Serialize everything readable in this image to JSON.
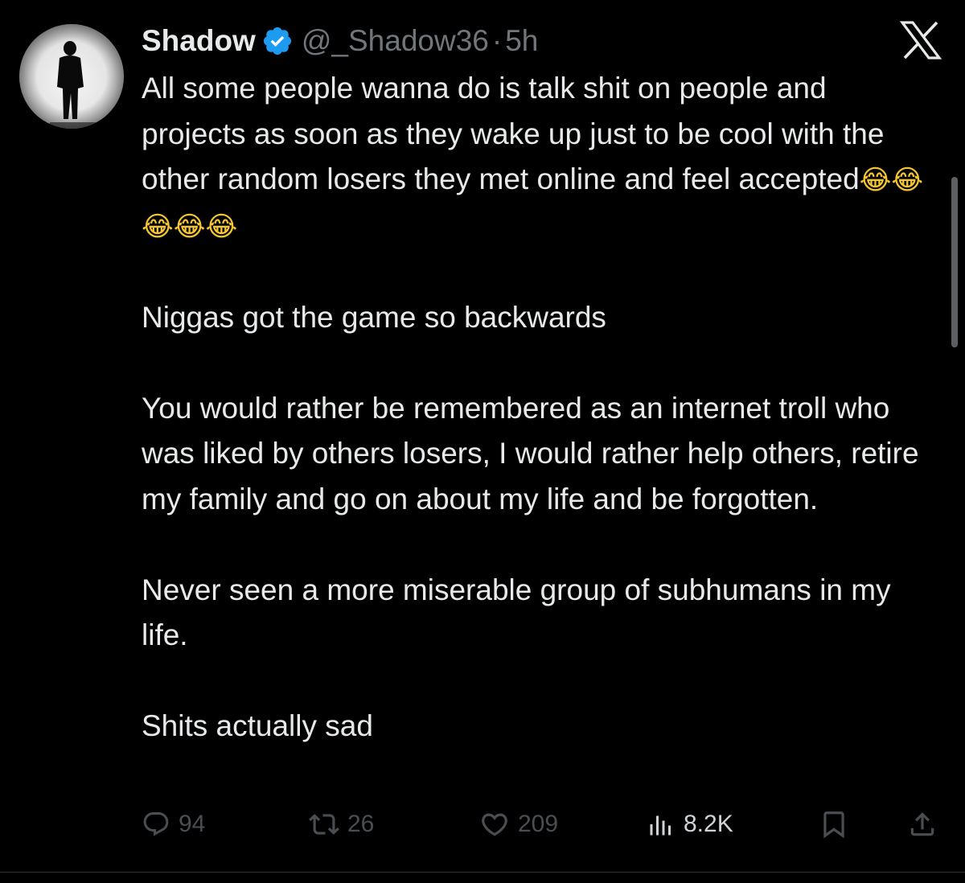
{
  "author": {
    "display_name": "Shadow",
    "handle": "@_Shadow36",
    "separator": "·",
    "timestamp": "5h",
    "verified": true,
    "verified_color": "#1d9bf0"
  },
  "app": {
    "logo_icon": "x-logo-icon"
  },
  "tweet": {
    "paragraphs": [
      "All some people wanna do is talk shit on people and projects as soon as they wake up just to be cool with the other random losers they met online and feel accepted",
      "Niggas got the game so backwards",
      "You would rather be remembered as an internet troll who was liked by others losers, I would rather help others, retire my family and go on about my life and be forgotten.",
      "Never seen a more miserable group of subhumans in my life.",
      "Shits actually sad"
    ],
    "emojis": "😂😂😂😂😂"
  },
  "actions": {
    "replies": "94",
    "reposts": "26",
    "likes": "209",
    "views": "8.2K"
  },
  "colors": {
    "background": "#000000",
    "text": "#e7e9ea",
    "muted": "#71767b",
    "action_icons": "#4a4e52"
  }
}
